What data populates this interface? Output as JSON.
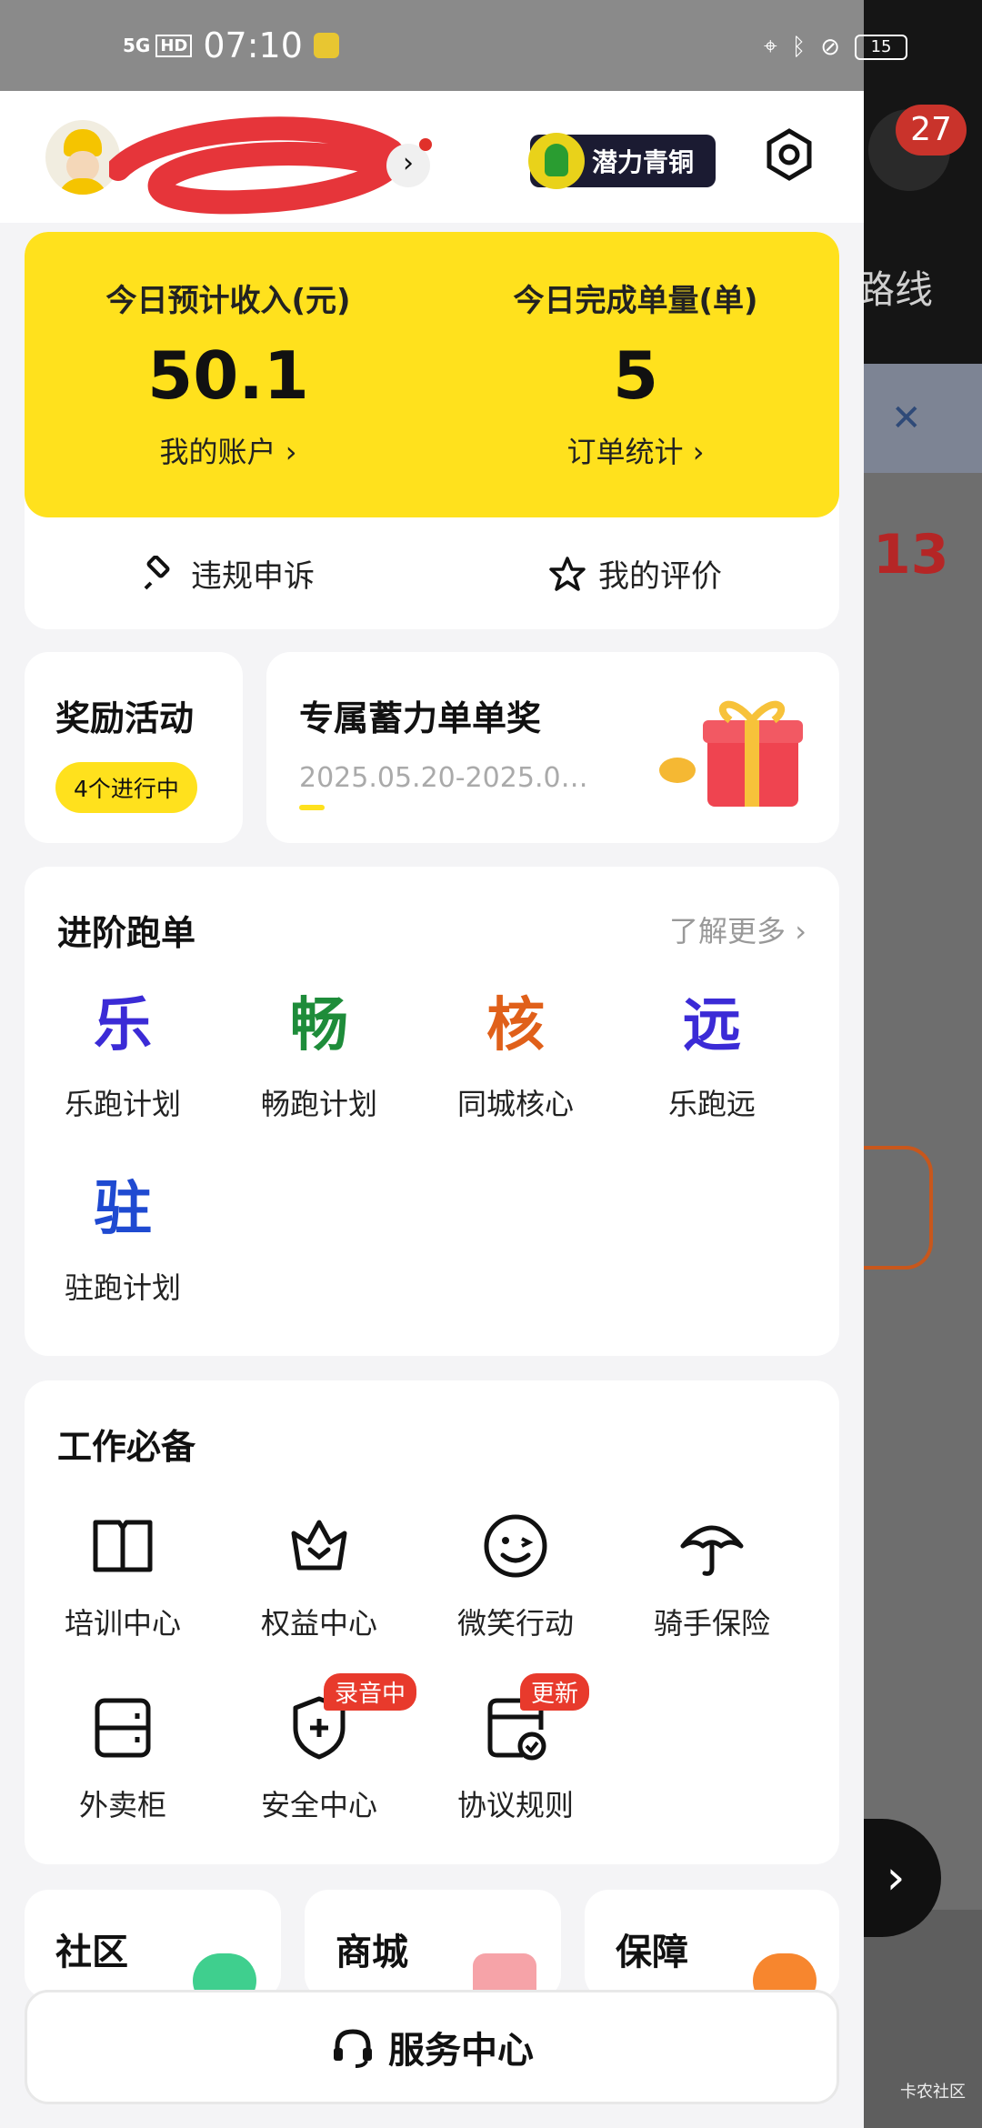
{
  "status_bar": {
    "network": "5G",
    "hd": "HD",
    "time": "07:10",
    "battery": "15"
  },
  "header": {
    "level_badge": "潜力青铜"
  },
  "background": {
    "notification_count": "27",
    "route_text": "路线",
    "number_text": "13",
    "watermark": "卡农社区"
  },
  "income_card": {
    "income_label": "今日预计收入(元)",
    "income_value": "50.1",
    "account_link": "我的账户",
    "orders_label": "今日完成单量(单)",
    "orders_value": "5",
    "orders_link": "订单统计",
    "appeal_label": "违规申诉",
    "rating_label": "我的评价"
  },
  "rewards": {
    "title": "奖励活动",
    "count_pill": "4个进行中"
  },
  "promo": {
    "title": "专属蓄力单单奖",
    "date_range": "2025.05.20-2025.0…"
  },
  "advance": {
    "title": "进阶跑单",
    "more": "了解更多",
    "items": [
      {
        "glyph": "乐",
        "label": "乐跑计划",
        "color": "#3b2bd6"
      },
      {
        "glyph": "畅",
        "label": "畅跑计划",
        "color": "#1e8c3a"
      },
      {
        "glyph": "核",
        "label": "同城核心",
        "color": "#e0601a"
      },
      {
        "glyph": "远",
        "label": "乐跑远",
        "color": "#3b2bd6"
      },
      {
        "glyph": "驻",
        "label": "驻跑计划",
        "color": "#1f4ad1"
      }
    ]
  },
  "tools": {
    "title": "工作必备",
    "items": [
      {
        "label": "培训中心",
        "icon": "book-icon"
      },
      {
        "label": "权益中心",
        "icon": "crown-icon"
      },
      {
        "label": "微笑行动",
        "icon": "smile-icon"
      },
      {
        "label": "骑手保险",
        "icon": "umbrella-icon"
      },
      {
        "label": "外卖柜",
        "icon": "locker-icon"
      },
      {
        "label": "安全中心",
        "icon": "shield-icon",
        "tag": "录音中"
      },
      {
        "label": "协议规则",
        "icon": "document-check-icon",
        "tag": "更新"
      }
    ]
  },
  "bottom_cards": {
    "community": "社区",
    "mall": "商城",
    "guarantee": "保障"
  },
  "service_button": "服务中心"
}
